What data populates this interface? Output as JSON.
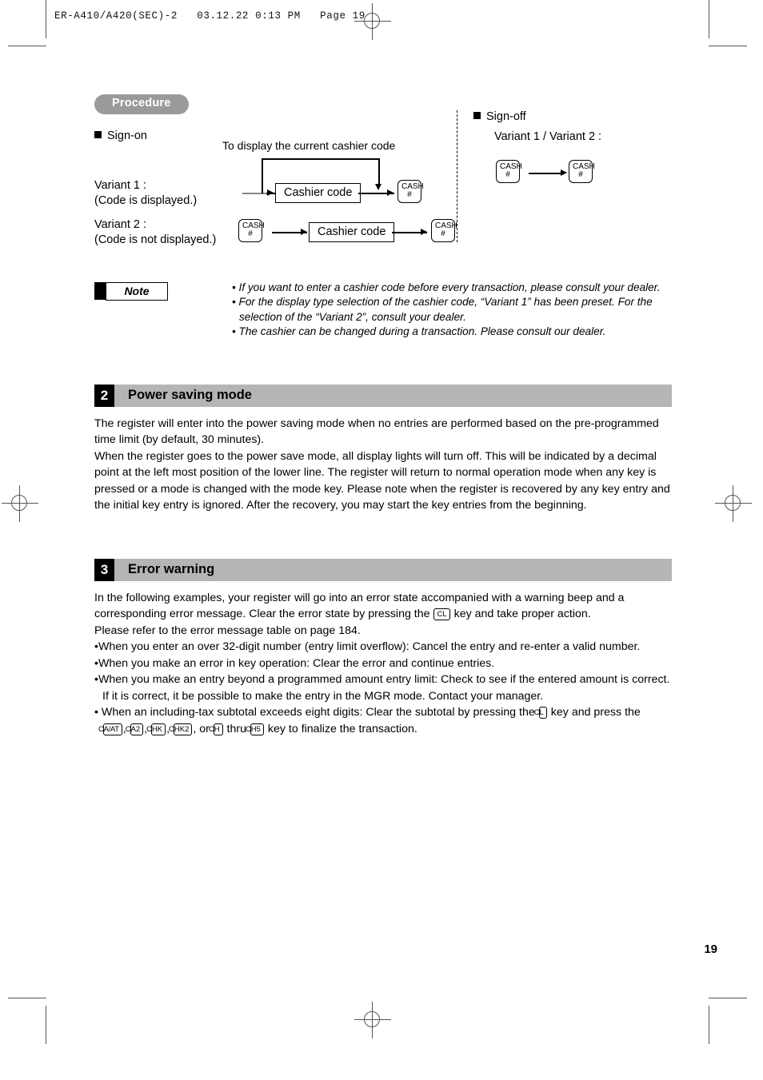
{
  "film_header": "ER-A410/A420(SEC)-2   03.12.22 0:13 PM   Page 19",
  "procedure": {
    "pill_label": "Procedure",
    "signon_label": "Sign-on",
    "signoff_label": "Sign-off",
    "signoff_variant_label": "Variant 1 / Variant 2 :",
    "caption_display_code": "To display the current cashier code",
    "variant1_line1": "Variant 1 :",
    "variant1_line2": "(Code is displayed.)",
    "variant2_line1": "Variant 2 :",
    "variant2_line2": "(Code is not displayed.)",
    "cashier_code_box": "Cashier code",
    "cash_key_top": "CASH",
    "cash_key_bottom": "#"
  },
  "note": {
    "tag": "Note",
    "items": [
      "If you want to enter a cashier code before every transaction, please consult your dealer.",
      "For the display type selection of the cashier code, “Variant 1” has been preset. For the selection of the “Variant 2”, consult your dealer.",
      "The cashier can be changed during a transaction. Please consult our dealer."
    ]
  },
  "section2": {
    "number": "2",
    "title": "Power saving mode",
    "para1": "The register will enter into the power saving mode when no entries are performed based on the pre-programmed time limit (by default, 30 minutes).",
    "para2": "When the register goes to the power save mode, all display lights will turn off. This will be indicated by a decimal point at the left most position of the lower line. The register will return to normal operation mode when any key is pressed or a mode is changed with the mode key. Please note when the register is recovered by any key entry and the initial key entry is ignored. After the recovery, you may start the key entries from the beginning."
  },
  "section3": {
    "number": "3",
    "title": "Error warning",
    "intro_part1": "In the following examples, your register will go into an error state accompanied with a warning beep and a corresponding error message.  Clear the error state by pressing the",
    "intro_key": "CL",
    "intro_part2": "key and take proper action.",
    "intro_line3": "Please refer to the error message table on page 184.",
    "bullet1": "When you enter an over 32-digit number (entry limit overflow): Cancel the entry and re-enter a valid number.",
    "bullet2": "When you make an error in key operation: Clear the error and continue entries.",
    "bullet3": "When you make an entry beyond a programmed amount entry limit: Check to see if the entered amount is correct.  If it is correct, it be possible to make the entry in the MGR mode.  Contact your manager.",
    "bullet4_part1": "When an including-tax subtotal exceeds eight digits: Clear the subtotal by pressing the",
    "bullet4_key_cl": "CL",
    "bullet4_part2": "key and press the",
    "bullet4_keys": [
      "CA/AT",
      "CA2",
      "CHK",
      "CHK2"
    ],
    "bullet4_or": ", or",
    "bullet4_key_ch": "CH",
    "bullet4_thru": "thru",
    "bullet4_key_ch5": "CH5",
    "bullet4_part3": "key to finalize the transaction."
  },
  "footer": {
    "page_number": "19"
  }
}
